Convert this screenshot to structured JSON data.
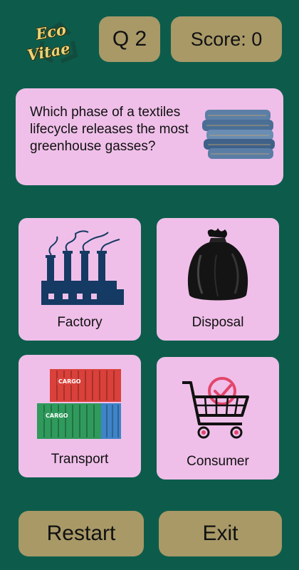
{
  "logo": {
    "line1": "Eco",
    "line2": "Vitae"
  },
  "header": {
    "question_number": "Q 2",
    "score": "Score: 0"
  },
  "question": {
    "text": "Which phase of a textiles lifecycle releases the most greenhouse gasses?"
  },
  "answers": [
    {
      "label": "Factory",
      "icon": "factory-icon"
    },
    {
      "label": "Disposal",
      "icon": "trash-bag-icon"
    },
    {
      "label": "Transport",
      "icon": "cargo-containers-icon"
    },
    {
      "label": "Consumer",
      "icon": "shopping-cart-icon"
    }
  ],
  "buttons": {
    "restart": "Restart",
    "exit": "Exit"
  },
  "colors": {
    "background": "#0d5c4b",
    "card": "#efbfe9",
    "button": "#a89967",
    "factory": "#153a63",
    "cart_accent": "#e3456b"
  },
  "container_labels": [
    "CARGO",
    "CARGO"
  ]
}
